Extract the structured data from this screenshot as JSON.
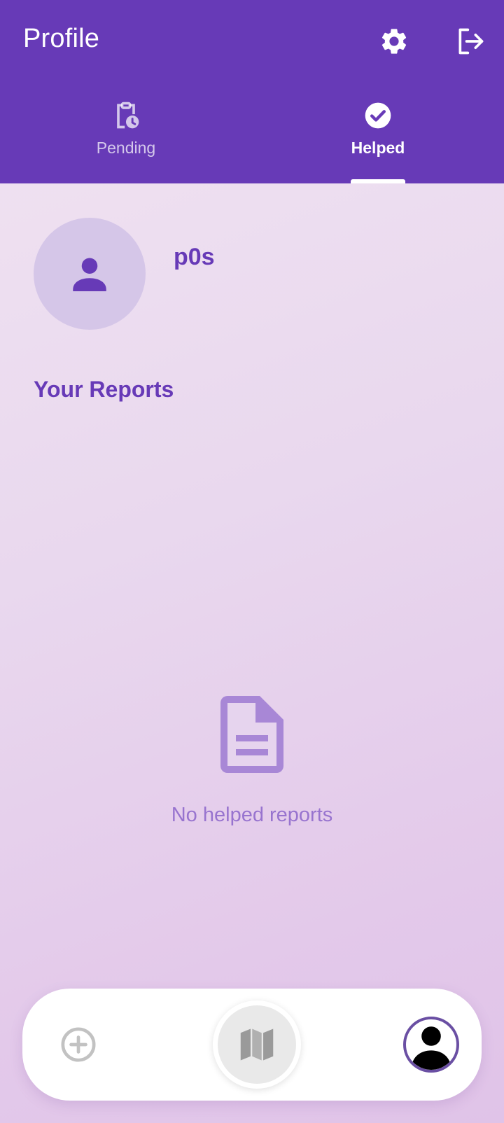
{
  "appbar": {
    "title": "Profile",
    "actions": [
      {
        "icon": "gear-icon"
      },
      {
        "icon": "logout-icon"
      }
    ],
    "color": "#673ab7"
  },
  "tabs": [
    {
      "label": "Pending",
      "icon": "clipboard-clock-icon",
      "selected": false
    },
    {
      "label": "Helped",
      "icon": "check-circle-icon",
      "selected": true
    }
  ],
  "profile": {
    "username": "p0s",
    "avatar_icon": "person-icon"
  },
  "reports": {
    "section_title": "Your Reports",
    "empty_icon": "document-icon",
    "empty_message": "No helped reports"
  },
  "bottom_nav": [
    {
      "icon": "add-circle-icon"
    },
    {
      "icon": "map-icon"
    },
    {
      "icon": "avatar-icon"
    }
  ]
}
